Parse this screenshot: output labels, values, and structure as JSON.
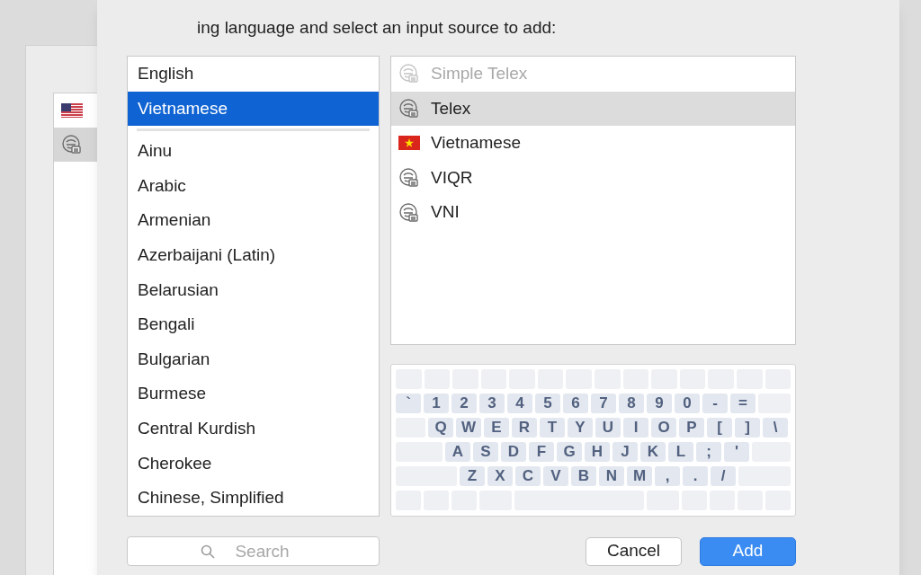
{
  "background_window": {
    "rows": [
      {
        "kind": "flag-us",
        "selected": false
      },
      {
        "kind": "input-method",
        "selected": true
      }
    ]
  },
  "dialog": {
    "prompt": "ing language and select an input source to add:",
    "languages": [
      {
        "label": "English",
        "selected": false,
        "separator_after": false
      },
      {
        "label": "Vietnamese",
        "selected": true,
        "separator_after": true
      },
      {
        "label": "Ainu",
        "selected": false,
        "separator_after": false
      },
      {
        "label": "Arabic",
        "selected": false,
        "separator_after": false
      },
      {
        "label": "Armenian",
        "selected": false,
        "separator_after": false
      },
      {
        "label": "Azerbaijani (Latin)",
        "selected": false,
        "separator_after": false
      },
      {
        "label": "Belarusian",
        "selected": false,
        "separator_after": false
      },
      {
        "label": "Bengali",
        "selected": false,
        "separator_after": false
      },
      {
        "label": "Bulgarian",
        "selected": false,
        "separator_after": false
      },
      {
        "label": "Burmese",
        "selected": false,
        "separator_after": false
      },
      {
        "label": "Central Kurdish",
        "selected": false,
        "separator_after": false
      },
      {
        "label": "Cherokee",
        "selected": false,
        "separator_after": false
      },
      {
        "label": "Chinese, Simplified",
        "selected": false,
        "separator_after": false
      }
    ],
    "input_sources": [
      {
        "kind": "input-method",
        "label": "Simple Telex",
        "selected": false,
        "disabled": true
      },
      {
        "kind": "input-method",
        "label": "Telex",
        "selected": true,
        "disabled": false
      },
      {
        "kind": "flag-vn",
        "label": "Vietnamese",
        "selected": false,
        "disabled": false
      },
      {
        "kind": "input-method",
        "label": "VIQR",
        "selected": false,
        "disabled": false
      },
      {
        "kind": "input-method",
        "label": "VNI",
        "selected": false,
        "disabled": false
      }
    ],
    "keyboard_rows": [
      [
        "`",
        "1",
        "2",
        "3",
        "4",
        "5",
        "6",
        "7",
        "8",
        "9",
        "0",
        "-",
        "="
      ],
      [
        "Q",
        "W",
        "E",
        "R",
        "T",
        "Y",
        "U",
        "I",
        "O",
        "P",
        "[",
        "]",
        "\\"
      ],
      [
        "A",
        "S",
        "D",
        "F",
        "G",
        "H",
        "J",
        "K",
        "L",
        ";",
        "'"
      ],
      [
        "Z",
        "X",
        "C",
        "V",
        "B",
        "N",
        "M",
        ",",
        ".",
        "/"
      ]
    ],
    "search": {
      "placeholder": "Search"
    },
    "buttons": [
      {
        "label": "Cancel",
        "kind": "secondary"
      },
      {
        "label": "Add",
        "kind": "primary"
      }
    ]
  }
}
